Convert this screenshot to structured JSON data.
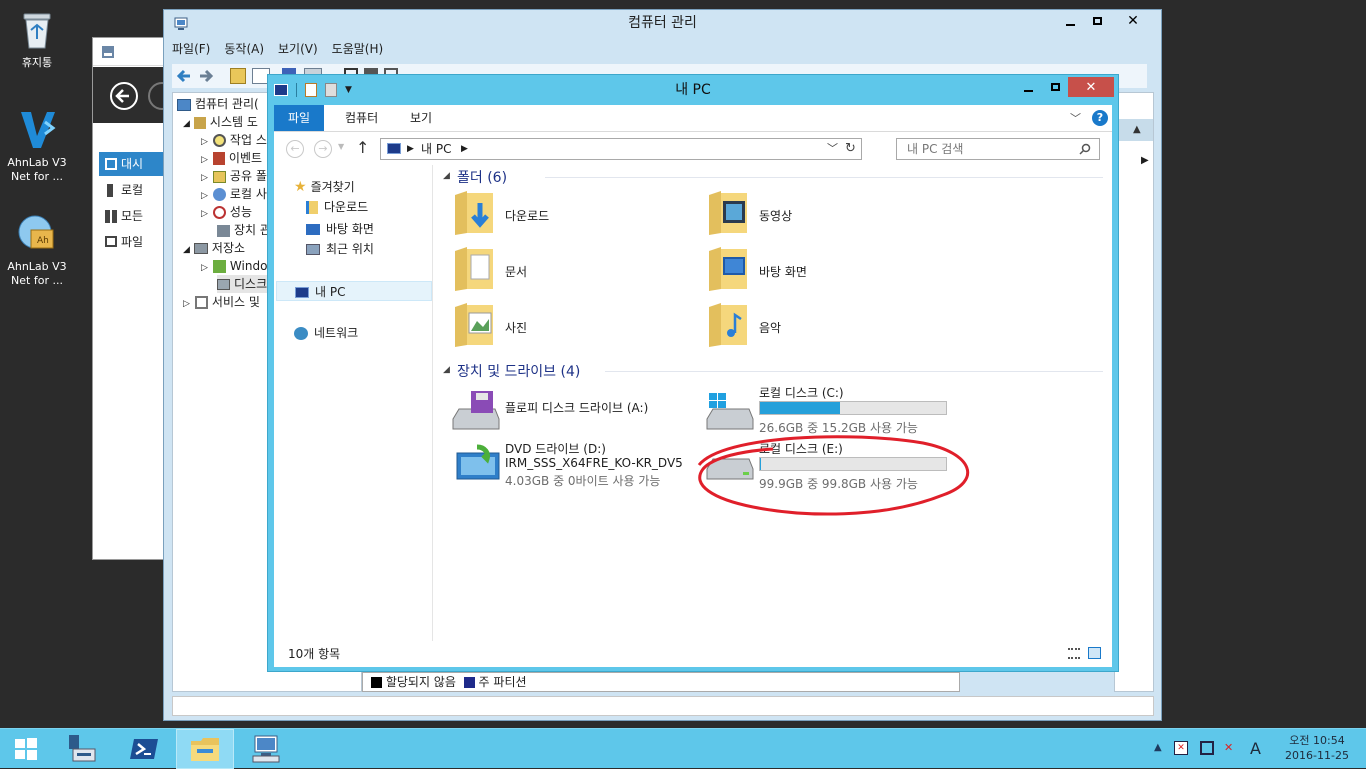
{
  "desktop": {
    "icons": [
      {
        "label": "휴지통"
      },
      {
        "label": "AhnLab V3 Net for ..."
      },
      {
        "label": "AhnLab V3 Net for ..."
      }
    ]
  },
  "server_manager": {
    "items": [
      "대시",
      "로컬",
      "모든",
      "파일"
    ]
  },
  "computer_management": {
    "title": "컴퓨터 관리",
    "menu": [
      "파일(F)",
      "동작(A)",
      "보기(V)",
      "도움말(H)"
    ],
    "tree": [
      "컴퓨터 관리(",
      "시스템 도",
      "작업 스",
      "이벤트",
      "공유 폴",
      "로컬 사",
      "성능",
      "장치 관",
      "저장소",
      "Windo",
      "디스크",
      "서비스 및"
    ],
    "legend": [
      "할당되지 않음",
      "주 파티션"
    ]
  },
  "explorer": {
    "title": "내 PC",
    "ribbon_tabs": [
      "파일",
      "컴퓨터",
      "보기"
    ],
    "address": "내 PC",
    "search_placeholder": "내 PC 검색",
    "nav": {
      "favorites": "즐겨찾기",
      "downloads": "다운로드",
      "desktop": "바탕 화면",
      "recent": "최근 위치",
      "this_pc": "내 PC",
      "network": "네트워크"
    },
    "folders_header": "폴더 (6)",
    "folders": [
      "다운로드",
      "동영상",
      "문서",
      "바탕 화면",
      "사진",
      "음악"
    ],
    "devices_header": "장치 및 드라이브 (4)",
    "drives": {
      "floppy": {
        "name": "플로피 디스크 드라이브 (A:)"
      },
      "c": {
        "name": "로컬 디스크 (C:)",
        "info": "26.6GB 중 15.2GB 사용 가능",
        "used_fraction": 0.43
      },
      "dvd": {
        "name": "DVD 드라이브 (D:)",
        "label": "IRM_SSS_X64FRE_KO-KR_DV5",
        "info": "4.03GB 중 0바이트 사용 가능"
      },
      "e": {
        "name": "로컬 디스크 (E:)",
        "info": "99.9GB 중 99.8GB 사용 가능",
        "used_fraction": 0.001
      }
    },
    "status": "10개 항목"
  },
  "taskbar": {
    "time": "오전 10:54",
    "date": "2016-11-25",
    "ime": "A"
  }
}
